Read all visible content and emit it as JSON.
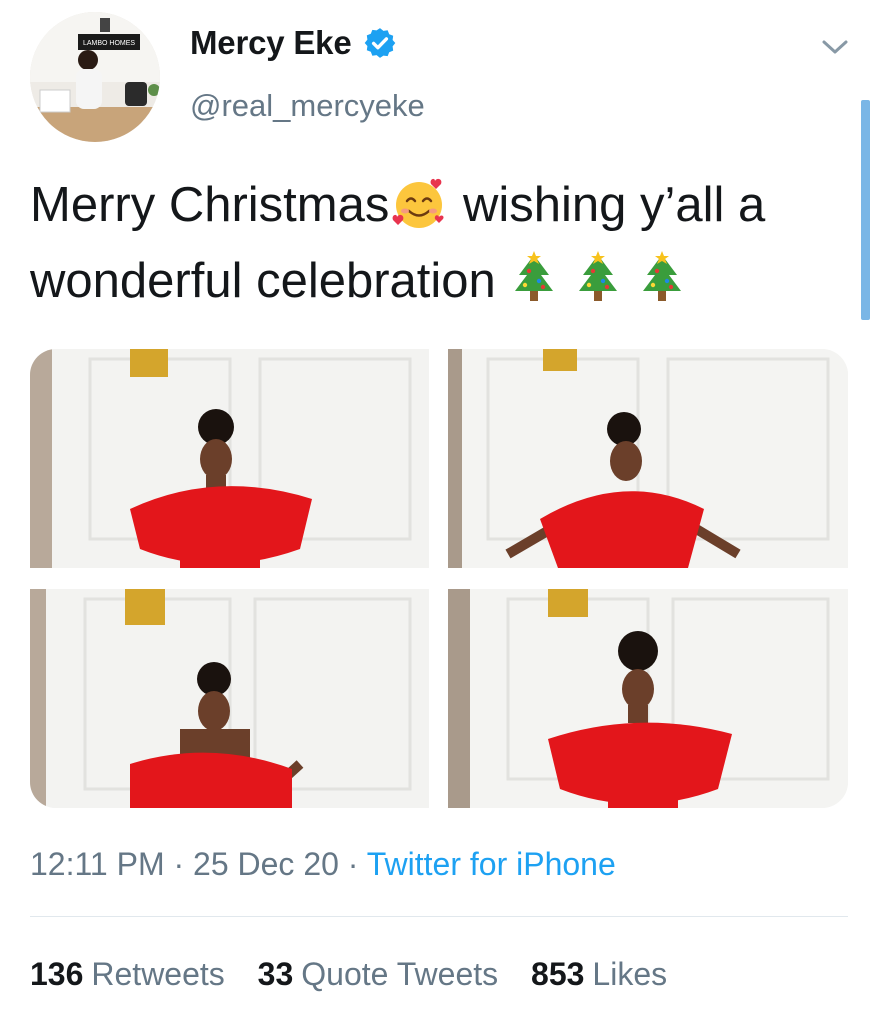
{
  "user": {
    "display_name": "Mercy Eke",
    "handle": "@real_mercyeke",
    "avatar_sign_text": "LAMBO HOMES",
    "verified_icon": "verified-badge-icon"
  },
  "tweet": {
    "text_part1": "Merry Christmas",
    "text_part2": " wishing y’all a wonderful celebration",
    "emojis": [
      "smiling-face-with-hearts-icon",
      "christmas-tree-icon",
      "christmas-tree-icon",
      "christmas-tree-icon"
    ]
  },
  "meta": {
    "time": "12:11 PM",
    "sep1": " · ",
    "date": "25 Dec 20",
    "sep2": " · ",
    "source": "Twitter for iPhone"
  },
  "stats": [
    {
      "count": "136",
      "label": "Retweets"
    },
    {
      "count": "33",
      "label": "Quote Tweets"
    },
    {
      "count": "853",
      "label": "Likes"
    }
  ],
  "colors": {
    "accent": "#1da1f2",
    "text": "#14171a",
    "secondary": "#657786",
    "dress": "#e3161b"
  }
}
